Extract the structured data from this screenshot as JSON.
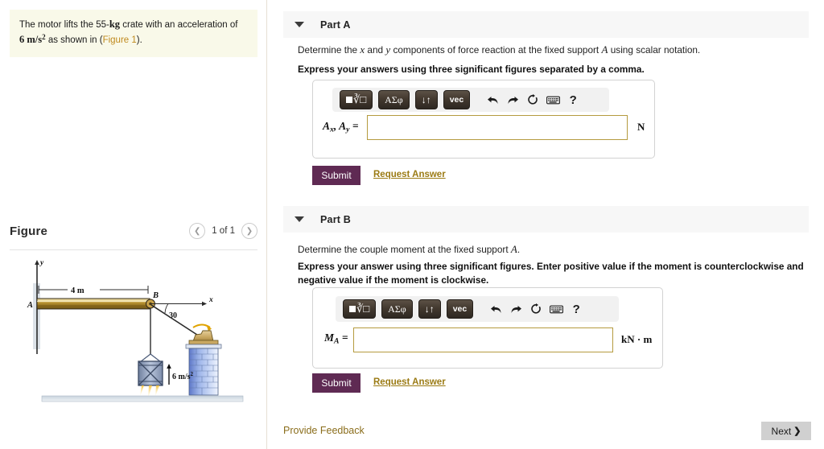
{
  "sidebar": {
    "problem_text_1": "The motor lifts the 55-",
    "problem_mass_unit": "kg",
    "problem_text_2": " crate with an acceleration of",
    "problem_accel": "6 m/s",
    "problem_accel_exp": "2",
    "problem_text_3": " as shown in (",
    "figure_link": "Figure 1",
    "problem_text_4": ").",
    "figure_title": "Figure",
    "figure_count": "1 of 1",
    "prev_icon": "chevron-left-icon",
    "next_icon": "chevron-right-icon"
  },
  "figure": {
    "label_y": "y",
    "label_x": "x",
    "label_A": "A",
    "label_B": "B",
    "label_span": "4 m",
    "label_angle": "30",
    "label_accel": "6 m/s",
    "label_accel_exp": "2"
  },
  "toolbar": {
    "btn_math": "math-template-button",
    "btn_greek": "ΑΣφ",
    "btn_arrows": "↓↑",
    "btn_vec": "vec",
    "icon_undo": "↰",
    "icon_redo": "↱",
    "icon_reset": "↻",
    "icon_keyboard": "⌨",
    "icon_help": "?"
  },
  "partA": {
    "header": "Part A",
    "prompt_pre": "Determine the ",
    "prompt_x": "x",
    "prompt_mid": " and ",
    "prompt_y": "y",
    "prompt_mid2": " components of force reaction at the fixed support ",
    "prompt_A": "A",
    "prompt_post": " using scalar notation.",
    "instruction": "Express your answers using three significant figures separated by a comma.",
    "answer_label_main": "A",
    "answer_label_sub1": "x",
    "answer_label_sep": ", A",
    "answer_label_sub2": "y",
    "answer_label_eq": " =",
    "answer_value": "",
    "unit": "N",
    "submit_label": "Submit",
    "request_label": "Request Answer"
  },
  "partB": {
    "header": "Part B",
    "prompt_pre": "Determine the couple moment at the fixed support ",
    "prompt_A": "A",
    "prompt_post": ".",
    "instruction": "Express your answer using three significant figures. Enter positive value if the moment is counterclockwise and negative value if the moment is clockwise.",
    "answer_label_main": "M",
    "answer_label_sub": "A",
    "answer_label_eq": " =",
    "answer_value": "",
    "unit": "kN · m",
    "submit_label": "Submit",
    "request_label": "Request Answer"
  },
  "footer": {
    "feedback_label": "Provide Feedback",
    "next_label": "Next",
    "next_icon": "chevron-right-icon"
  },
  "colors": {
    "submit_purple": "#5f2a53",
    "link_gold": "#9b7b14",
    "input_border": "#b59b3f",
    "problem_bg": "#f9f9e9",
    "header_bg": "#f7f7f7"
  }
}
